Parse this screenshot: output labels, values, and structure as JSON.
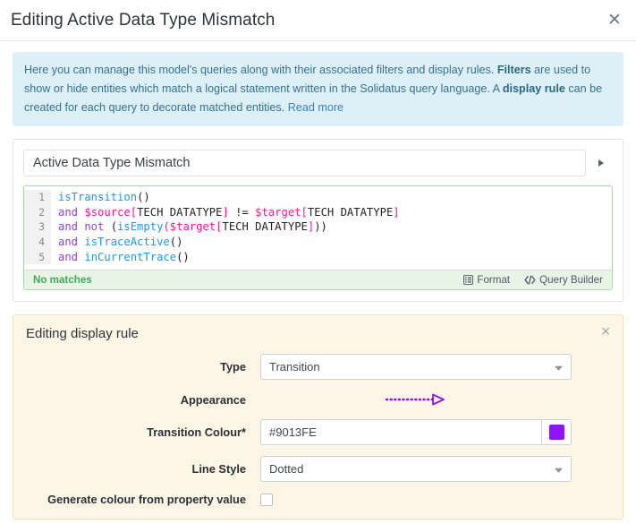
{
  "header": {
    "title": "Editing Active Data Type Mismatch",
    "close_label": "✕"
  },
  "info_banner": {
    "part1": "Here you can manage this model's queries along with their associated filters and display rules. ",
    "bold1": "Filters",
    "part2": " are used to show or hide entities which match a logical statement written in the Solidatus query language. A ",
    "bold2": "display rule",
    "part3": " can be created for each query to decorate matched entities. ",
    "link": "Read more"
  },
  "query": {
    "name_value": "Active Data Type Mismatch",
    "name_placeholder": "Query name",
    "expander_icon": "triangle-right-icon",
    "editor": {
      "line_numbers": [
        "1",
        "2",
        "3",
        "4",
        "5"
      ],
      "lines": [
        [
          {
            "t": "isTransition",
            "c": "fn"
          },
          {
            "t": "()",
            "c": "plain"
          }
        ],
        [
          {
            "t": "and ",
            "c": "kw"
          },
          {
            "t": "$source",
            "c": "var"
          },
          {
            "t": "[",
            "c": "brk"
          },
          {
            "t": "TECH DATATYPE",
            "c": "plain"
          },
          {
            "t": "]",
            "c": "brk"
          },
          {
            "t": " != ",
            "c": "plain"
          },
          {
            "t": "$target",
            "c": "var"
          },
          {
            "t": "[",
            "c": "brk"
          },
          {
            "t": "TECH DATATYPE",
            "c": "plain"
          },
          {
            "t": "]",
            "c": "brk"
          }
        ],
        [
          {
            "t": "and not ",
            "c": "kw"
          },
          {
            "t": "(",
            "c": "plain"
          },
          {
            "t": "isEmpty",
            "c": "fn"
          },
          {
            "t": "(",
            "c": "brk"
          },
          {
            "t": "$target",
            "c": "var"
          },
          {
            "t": "[",
            "c": "brk"
          },
          {
            "t": "TECH DATATYPE",
            "c": "plain"
          },
          {
            "t": "]",
            "c": "brk"
          },
          {
            "t": "))",
            "c": "plain"
          }
        ],
        [
          {
            "t": "and ",
            "c": "kw"
          },
          {
            "t": "isTraceActive",
            "c": "fn"
          },
          {
            "t": "()",
            "c": "plain"
          }
        ],
        [
          {
            "t": "and ",
            "c": "kw"
          },
          {
            "t": "inCurrentTrace",
            "c": "fn"
          },
          {
            "t": "()",
            "c": "plain"
          }
        ]
      ],
      "status": "No matches",
      "format_label": "Format",
      "query_builder_label": "Query Builder"
    }
  },
  "display_rule": {
    "title": "Editing display rule",
    "close_label": "×",
    "fields": {
      "type_label": "Type",
      "type_value": "Transition",
      "appearance_label": "Appearance",
      "colour_label": "Transition Colour*",
      "colour_value": "#9013FE",
      "colour_placeholder": "#000000",
      "line_style_label": "Line Style",
      "line_style_value": "Dotted",
      "generate_colour_label": "Generate colour from property value",
      "generate_colour_checked": false
    }
  },
  "colors": {
    "transition_colour": "#9013FE",
    "banner_bg": "#ddf0f7",
    "editor_border": "#a8d5a8",
    "status_green": "#3faa5c",
    "rule_panel_bg": "#fdf6e6",
    "rule_panel_border": "#f0dfb8"
  }
}
